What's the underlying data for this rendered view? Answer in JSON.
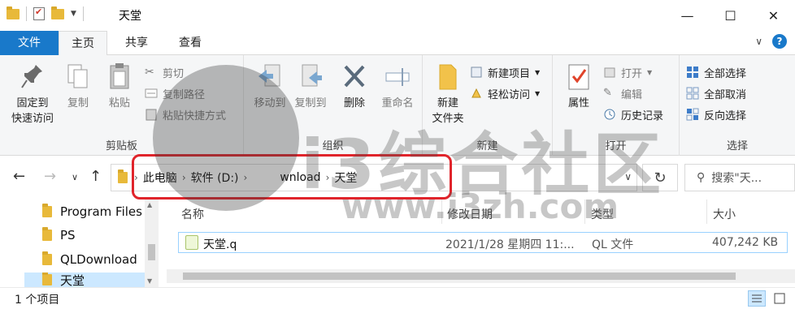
{
  "window": {
    "title": "天堂"
  },
  "ribbon_tabs": [
    "文件",
    "主页",
    "共享",
    "查看"
  ],
  "ribbon": {
    "clipboard": {
      "label": "剪贴板",
      "pin": "固定到\n快速访问",
      "pin_line1": "固定到",
      "pin_line2": "快速访问",
      "copy": "复制",
      "paste": "粘贴",
      "cut": "剪切",
      "copy_path": "复制路径",
      "paste_shortcut": "粘贴快捷方式"
    },
    "organize": {
      "label": "组织",
      "move_to": "移动到",
      "copy_to": "复制到",
      "delete": "删除",
      "rename": "重命名"
    },
    "new": {
      "label": "新建",
      "new_folder_line1": "新建",
      "new_folder_line2": "文件夹",
      "new_item": "新建项目",
      "easy_access": "轻松访问"
    },
    "open": {
      "label": "打开",
      "properties": "属性",
      "open": "打开",
      "edit": "编辑",
      "history": "历史记录"
    },
    "select": {
      "label": "选择",
      "select_all": "全部选择",
      "select_none": "全部取消",
      "invert": "反向选择"
    }
  },
  "address": {
    "crumbs": [
      "此电脑",
      "软件 (D:)",
      "wnload",
      "天堂"
    ],
    "search_placeholder": "搜索\"天..."
  },
  "nav_pane": {
    "items": [
      "Program Files",
      "PS",
      "QLDownload",
      "天堂"
    ]
  },
  "file_list": {
    "columns": [
      "名称",
      "修改日期",
      "类型",
      "大小"
    ],
    "rows": [
      {
        "name": "天堂.q",
        "modified": "2021/1/28 星期四 11:...",
        "type": "QL 文件",
        "size": "407,242 KB"
      }
    ]
  },
  "status": {
    "count_text": "1 个项目"
  },
  "watermark": {
    "brand": "i3综合社区",
    "url": "www.i3zh.com"
  },
  "colors": {
    "accent": "#1979ca",
    "highlight_box": "#e0242b",
    "folder": "#e8b93a"
  }
}
